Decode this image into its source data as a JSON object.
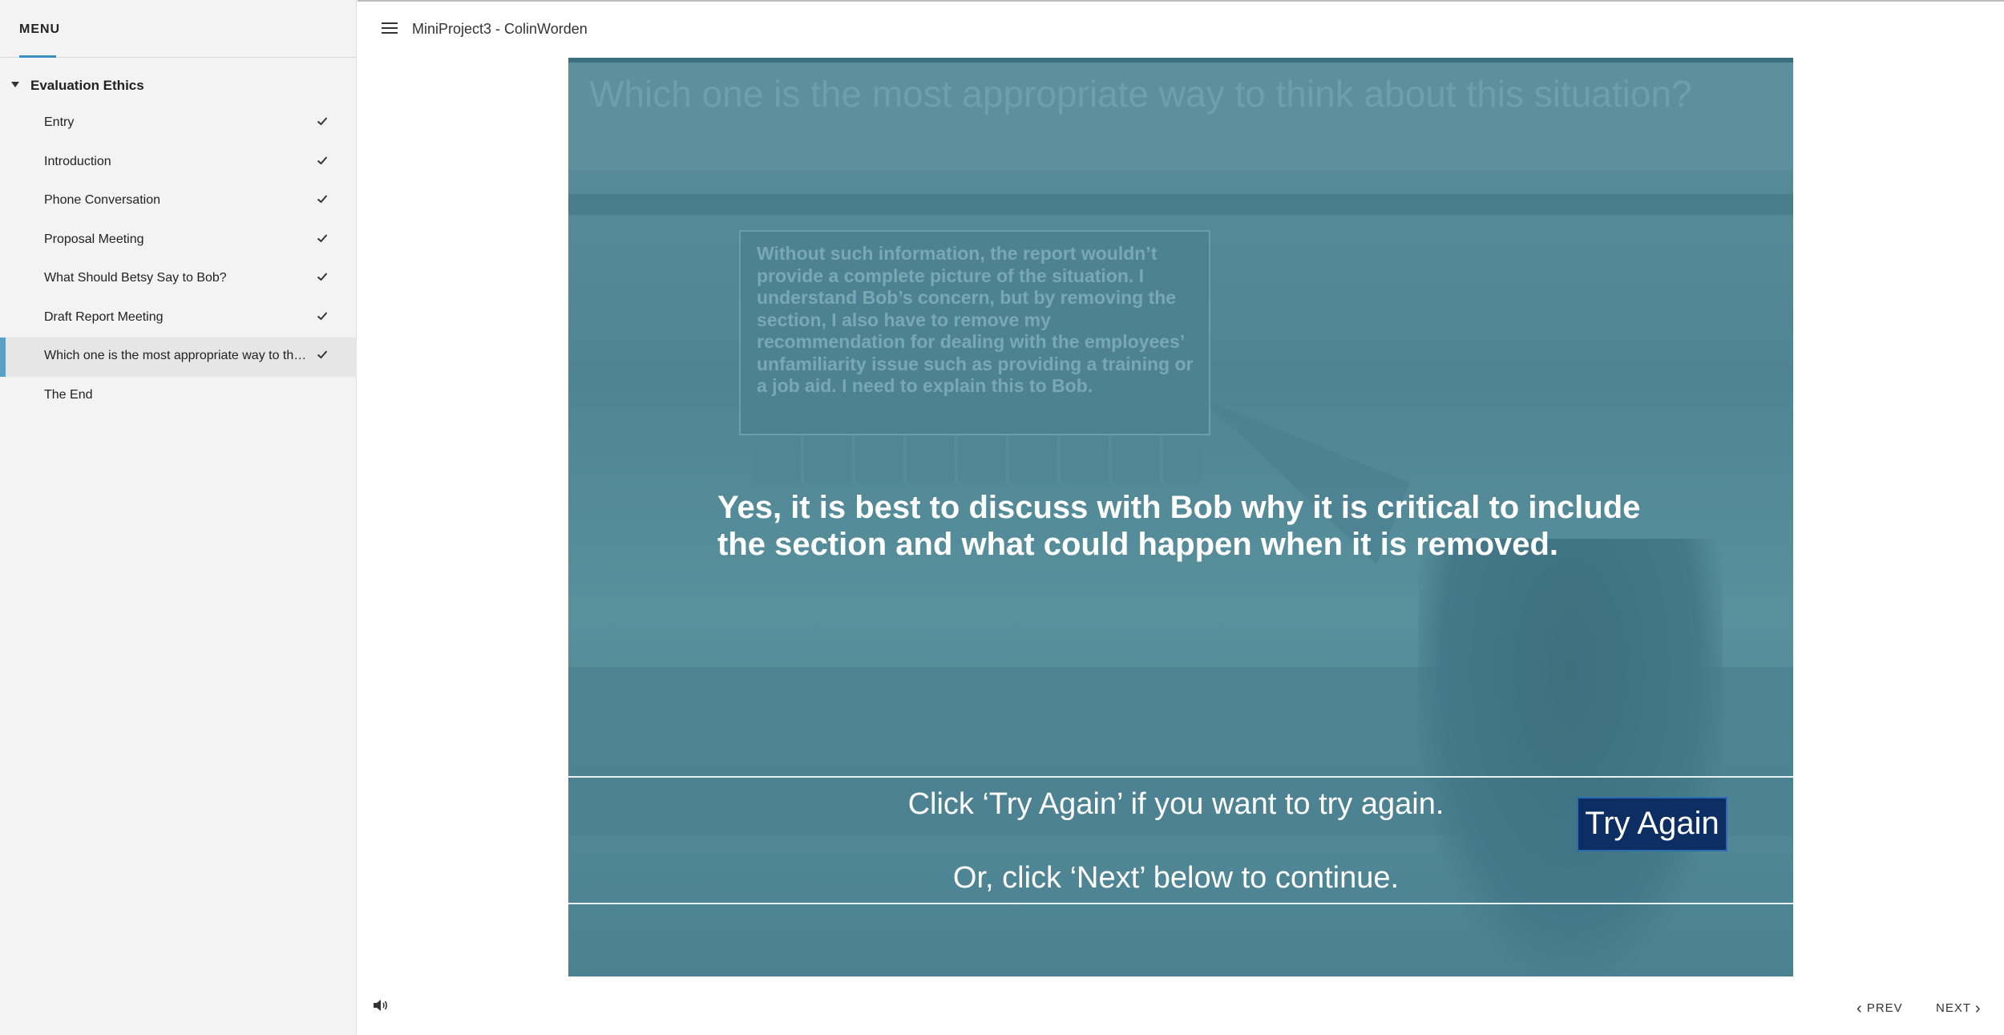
{
  "sidebar": {
    "menu_label": "MENU",
    "section_label": "Evaluation Ethics",
    "items": [
      {
        "label": "Entry",
        "completed": true,
        "active": false
      },
      {
        "label": "Introduction",
        "completed": true,
        "active": false
      },
      {
        "label": "Phone Conversation",
        "completed": true,
        "active": false
      },
      {
        "label": "Proposal Meeting",
        "completed": true,
        "active": false
      },
      {
        "label": "What Should Betsy Say to Bob?",
        "completed": true,
        "active": false
      },
      {
        "label": "Draft Report Meeting",
        "completed": true,
        "active": false
      },
      {
        "label": "Which one is the most appropriate way to think about this situation?",
        "completed": true,
        "active": true
      },
      {
        "label": "The End",
        "completed": false,
        "active": false
      }
    ]
  },
  "header": {
    "course_title": "MiniProject3 - ColinWorden"
  },
  "slide": {
    "question": "Which one is the most appropriate way to think about this situation?",
    "speech_bubble": "Without such information, the report wouldn’t provide a complete picture of the situation. I understand Bob’s concern, but by removing the section, I also have to remove my recommendation for dealing with the employees’ unfamiliarity issue such as providing a training or a job aid. I need to explain this to Bob.",
    "feedback": "Yes, it is best to discuss with Bob why it is critical to include the section and what could happen when it is removed.",
    "instruction_line1": "Click ‘Try Again’ if you want to try again.",
    "instruction_line2": "Or, click ‘Next’ below to continue.",
    "try_again_label": "Try Again"
  },
  "footer": {
    "prev_label": "PREV",
    "next_label": "NEXT",
    "volume_icon": "volume-icon"
  },
  "colors": {
    "accent": "#3a8fc2",
    "slide_overlay": "#4f8494",
    "try_again_bg": "#0d2e63"
  }
}
